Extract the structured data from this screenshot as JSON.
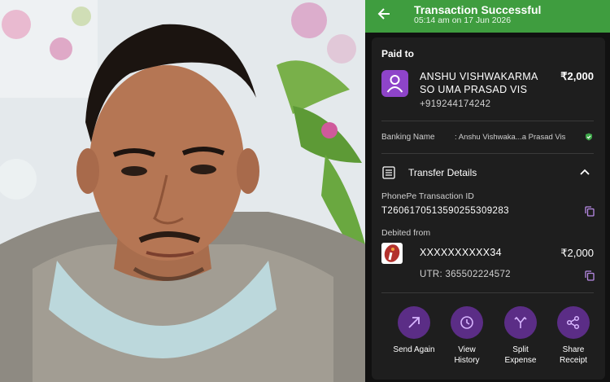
{
  "header": {
    "title": "Transaction Successful",
    "timestamp": "05:14 am on 17 Jun 2026"
  },
  "payee": {
    "section_label": "Paid to",
    "name_line1": "ANSHU VISHWAKARMA",
    "name_line2": "SO UMA PRASAD VIS",
    "amount": "₹2,000",
    "phone": "+919244174242"
  },
  "banking": {
    "label": "Banking Name",
    "value": ":  Anshu Vishwaka...a Prasad Vis"
  },
  "transfer_details": {
    "label": "Transfer Details",
    "txn_id_label": "PhonePe Transaction ID",
    "txn_id": "T2606170513590255309283",
    "debited_label": "Debited from",
    "account": "XXXXXXXXXX34",
    "account_amount": "₹2,000",
    "utr": "UTR: 365502224572"
  },
  "actions": [
    {
      "label1": "Send Again",
      "label2": ""
    },
    {
      "label1": "View",
      "label2": "History"
    },
    {
      "label1": "Split",
      "label2": "Expense"
    },
    {
      "label1": "Share",
      "label2": "Receipt"
    }
  ],
  "colors": {
    "header_green": "#3f9d3f",
    "accent_purple": "#8e44c9",
    "action_circle": "#5b2d86",
    "card_bg": "#1e1e1e"
  },
  "icons": [
    "back-arrow-icon",
    "user-icon",
    "verified-icon",
    "list-icon",
    "chevron-up-icon",
    "copy-icon",
    "bank-logo-icon",
    "send-arrow-icon",
    "clock-icon",
    "split-icon",
    "share-icon"
  ]
}
